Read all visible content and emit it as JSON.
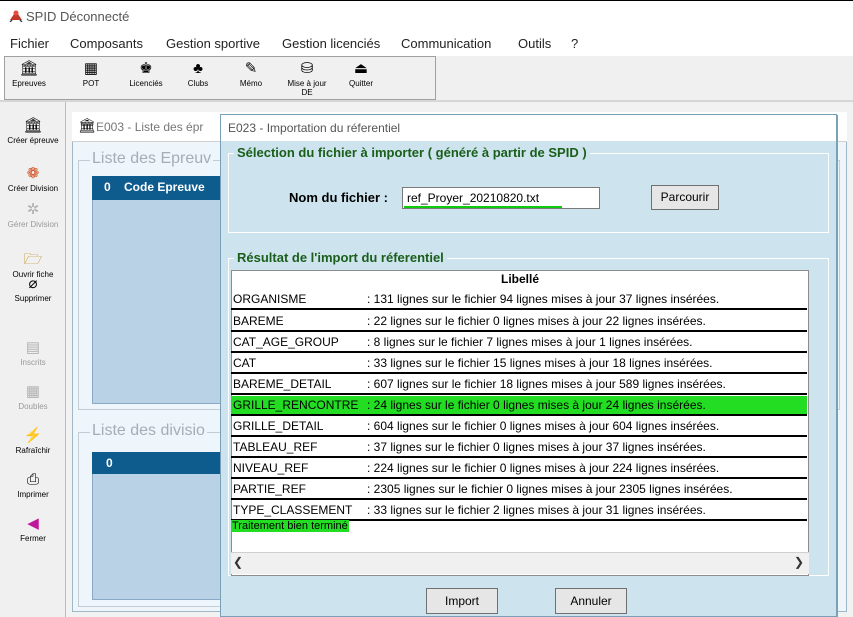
{
  "app": {
    "title": "SPID Déconnecté"
  },
  "menu": [
    "Fichier",
    "Composants",
    "Gestion sportive",
    "Gestion licenciés",
    "Communication",
    "Outils",
    "?"
  ],
  "toolbar": [
    {
      "label": "Epreuves",
      "icon": "building-icon"
    },
    {
      "label": "POT",
      "icon": "grid-icon"
    },
    {
      "label": "Licenciés",
      "icon": "person-icon"
    },
    {
      "label": "Clubs",
      "icon": "clubs-icon"
    },
    {
      "label": "Mémo",
      "icon": "memo-icon"
    },
    {
      "label": "Mise à jour DE",
      "icon": "database-icon"
    },
    {
      "label": "Quitter",
      "icon": "exit-icon"
    }
  ],
  "sidebar": [
    {
      "label": "Créer épreuve",
      "icon": "building-icon",
      "enabled": true
    },
    {
      "label": "Créer Division",
      "icon": "color-wheel-icon",
      "enabled": true
    },
    {
      "label": "Gérer Division",
      "icon": "sparkle-icon",
      "enabled": false
    },
    {
      "label": "Ouvrir fiche",
      "icon": "folder-icon",
      "enabled": true
    },
    {
      "label": "Supprimer",
      "icon": "eraser-icon",
      "enabled": true
    },
    {
      "label": "Inscrits",
      "icon": "document-icon",
      "enabled": false
    },
    {
      "label": "Doubles",
      "icon": "doubles-icon",
      "enabled": false
    },
    {
      "label": "Rafraîchir",
      "icon": "lightning-icon",
      "enabled": true
    },
    {
      "label": "Imprimer",
      "icon": "printer-icon",
      "enabled": true
    },
    {
      "label": "Fermer",
      "icon": "arrow-left-icon",
      "enabled": true
    }
  ],
  "background_window": {
    "title": "E003 - Liste des épr",
    "group1_title": "Liste des Epreuv",
    "grid1_col0": "0",
    "grid1_col1": "Code Epreuve",
    "group2_title": "Liste des divisio",
    "grid2_col0": "0",
    "close_label": "✕"
  },
  "dialog": {
    "title": "E023 - Importation du réferentiel",
    "file_group_title": "Sélection du fichier à importer ( généré à partir de SPID )",
    "file_label": "Nom du fichier :",
    "file_value": "ref_Proyer_20210820.txt",
    "browse_label": "Parcourir",
    "result_group_title": "Résultat de l'import du réferentiel",
    "column_header": "Libellé",
    "rows": [
      {
        "name": "ORGANISME",
        "detail": ": 131  lignes sur le fichier    94  lignes mises à jour   37  lignes insérées.",
        "highlight": false
      },
      {
        "name": "BAREME",
        "detail": ": 22  lignes sur le fichier    0  lignes mises à jour   22  lignes insérées.",
        "highlight": false
      },
      {
        "name": "CAT_AGE_GROUP",
        "detail": ": 8  lignes sur le fichier    7  lignes mises à jour   1  lignes insérées.",
        "highlight": false
      },
      {
        "name": "CAT",
        "detail": ": 33  lignes sur le fichier    15  lignes mises à jour   18  lignes insérées.",
        "highlight": false
      },
      {
        "name": "BAREME_DETAIL",
        "detail": ": 607  lignes sur le fichier    18  lignes mises à jour   589  lignes insérées.",
        "highlight": false
      },
      {
        "name": "GRILLE_RENCONTRE",
        "detail": ": 24  lignes sur le fichier    0  lignes mises à jour   24  lignes insérées.",
        "highlight": true
      },
      {
        "name": "GRILLE_DETAIL",
        "detail": ": 604  lignes sur le fichier    0  lignes mises à jour   604  lignes insérées.",
        "highlight": false
      },
      {
        "name": "TABLEAU_REF",
        "detail": ": 37  lignes sur le fichier    0  lignes mises à jour   37  lignes insérées.",
        "highlight": false
      },
      {
        "name": "NIVEAU_REF",
        "detail": ": 224  lignes sur le fichier    0  lignes mises à jour   224  lignes insérées.",
        "highlight": false
      },
      {
        "name": "PARTIE_REF",
        "detail": ": 2305  lignes sur le fichier    0  lignes mises à jour   2305  lignes insérées.",
        "highlight": false
      },
      {
        "name": "TYPE_CLASSEMENT",
        "detail": ": 33  lignes sur le fichier    2  lignes mises à jour   31  lignes insérées.",
        "highlight": false
      }
    ],
    "status": "Traitement bien terminé",
    "import_label": "Import",
    "cancel_label": "Annuler"
  },
  "colors": {
    "highlight": "#22dd22",
    "group_title": "#1a5e1a",
    "dialog_bg": "#cde3ee",
    "grid_header": "#0e5b8e"
  }
}
